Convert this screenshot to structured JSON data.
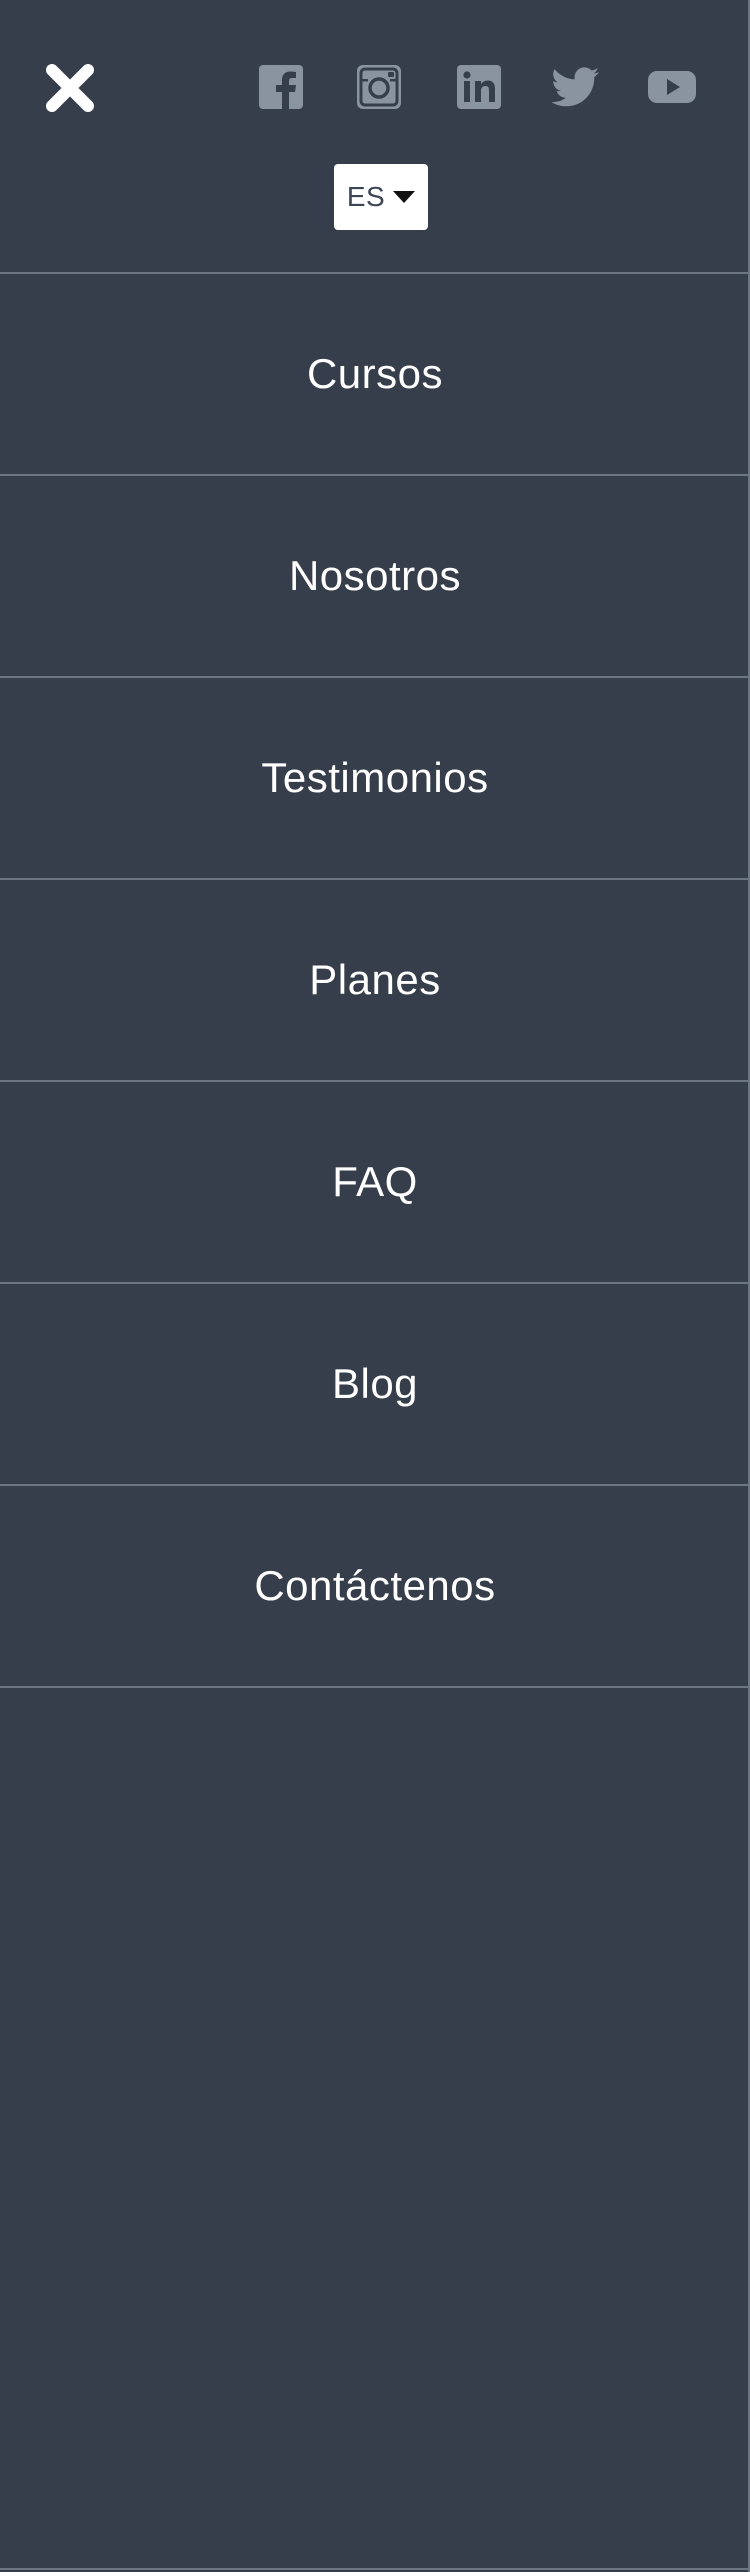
{
  "colors": {
    "background": "#353e4a",
    "divider": "#6b7682",
    "icon_muted": "#8a94a0",
    "text": "#ffffff",
    "close_icon": "#ffffff",
    "lang_bg": "#ffffff",
    "lang_text": "#3c4653"
  },
  "header": {
    "close_icon": "close-icon",
    "socials": [
      {
        "name": "facebook",
        "icon": "facebook-icon"
      },
      {
        "name": "instagram",
        "icon": "instagram-icon"
      },
      {
        "name": "linkedin",
        "icon": "linkedin-icon"
      },
      {
        "name": "twitter",
        "icon": "twitter-icon"
      },
      {
        "name": "youtube",
        "icon": "youtube-icon"
      }
    ],
    "language": {
      "selected": "ES",
      "icon": "caret-down-icon"
    }
  },
  "menu": {
    "items": [
      {
        "label": "Cursos"
      },
      {
        "label": "Nosotros"
      },
      {
        "label": "Testimonios"
      },
      {
        "label": "Planes"
      },
      {
        "label": "FAQ"
      },
      {
        "label": "Blog"
      },
      {
        "label": "Contáctenos"
      }
    ]
  }
}
